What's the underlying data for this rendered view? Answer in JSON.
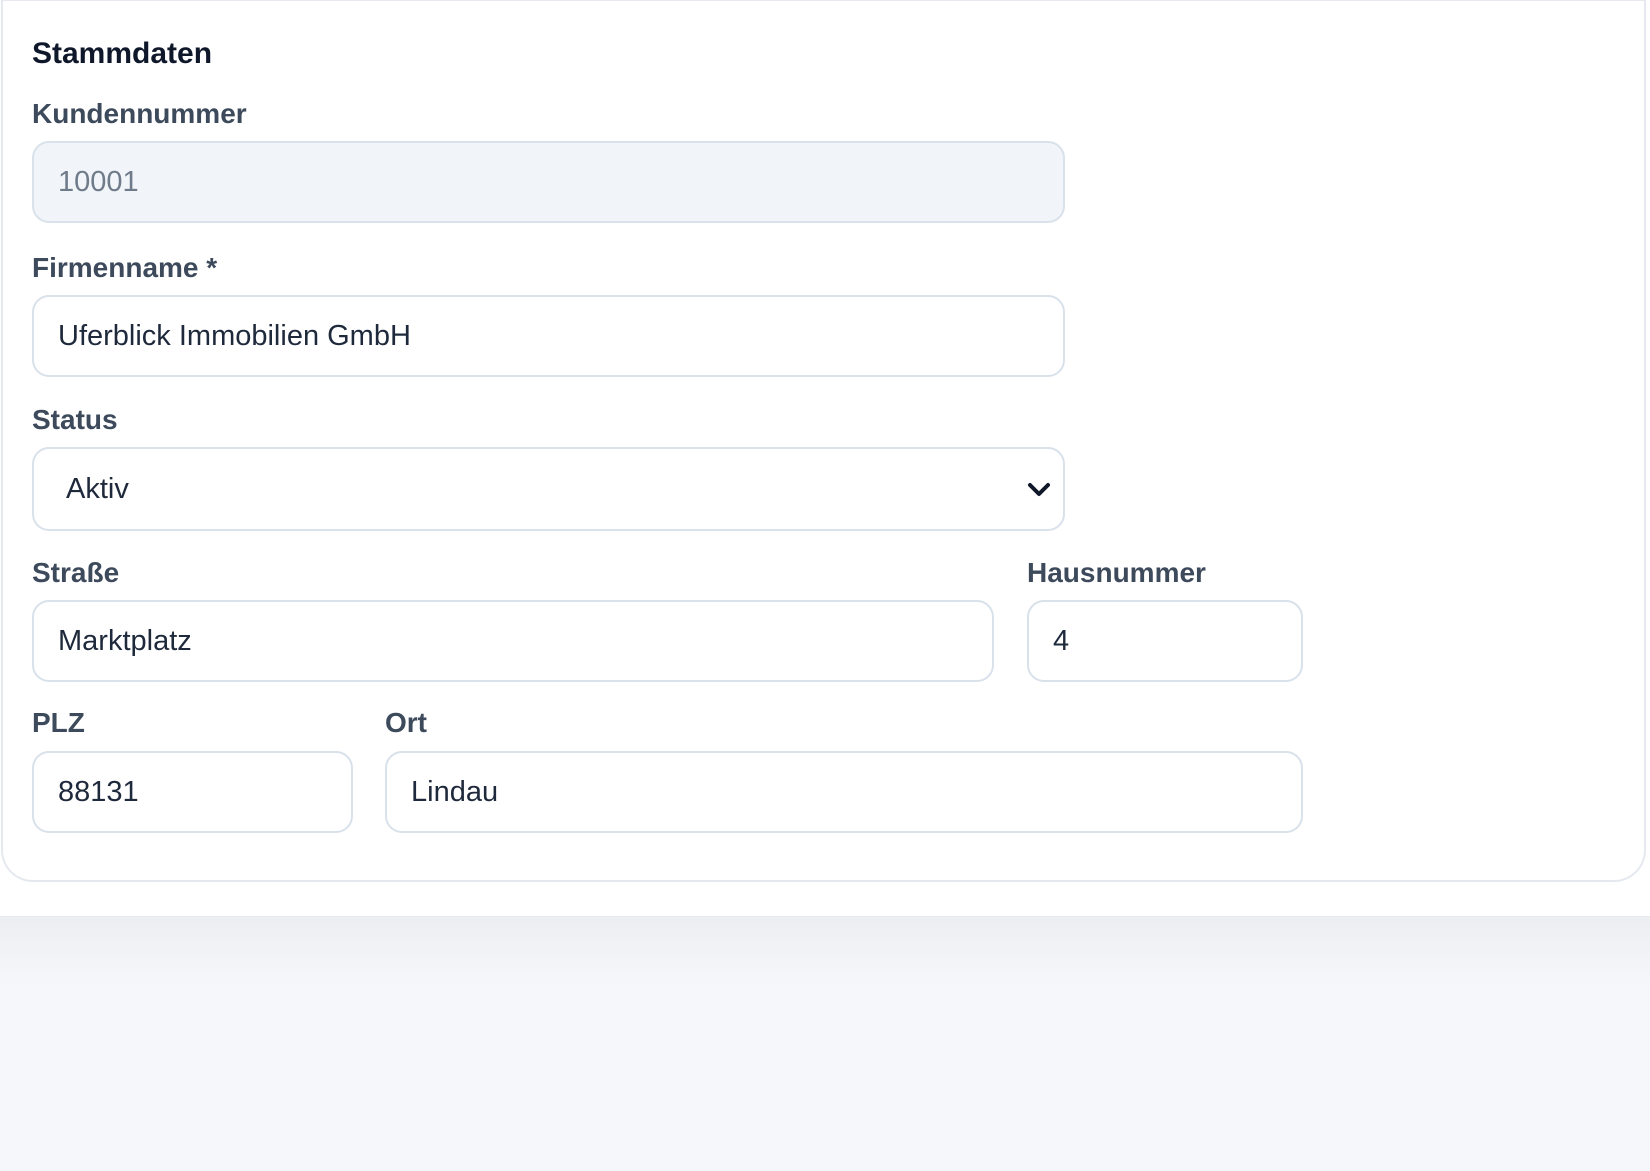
{
  "section": {
    "title": "Stammdaten"
  },
  "fields": {
    "kundennummer": {
      "label": "Kundennummer",
      "value": "10001"
    },
    "firmenname": {
      "label": "Firmenname *",
      "value": "Uferblick Immobilien GmbH"
    },
    "status": {
      "label": "Status",
      "value": "Aktiv",
      "icon": "chevron-down-icon"
    },
    "strasse": {
      "label": "Straße",
      "value": "Marktplatz"
    },
    "hausnummer": {
      "label": "Hausnummer",
      "value": "4"
    },
    "plz": {
      "label": "PLZ",
      "value": "88131"
    },
    "ort": {
      "label": "Ort",
      "value": "Lindau"
    }
  },
  "colors": {
    "label": "#3d4a5c",
    "input_border": "#d9e1ea",
    "readonly_background": "#f1f5f9",
    "page_background": "#f5f7fa"
  }
}
